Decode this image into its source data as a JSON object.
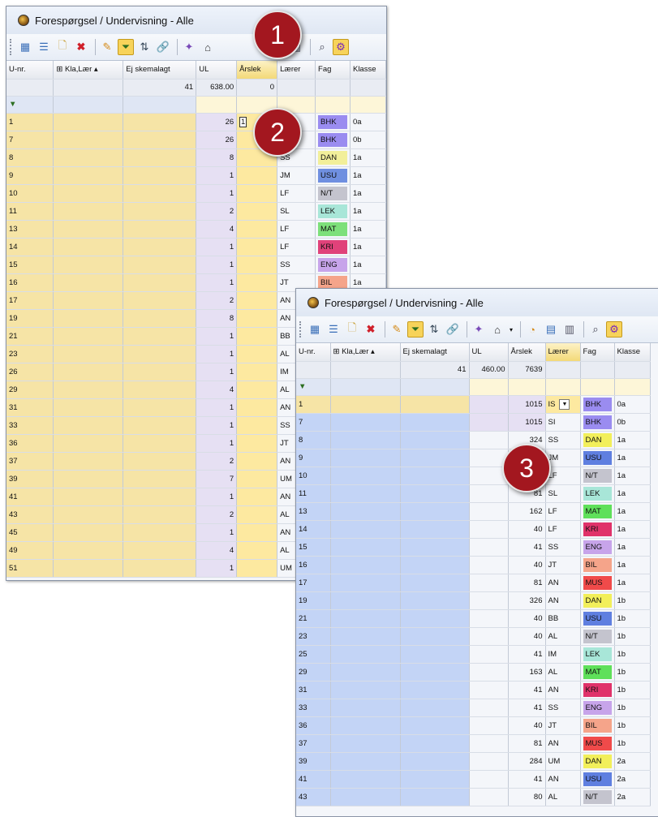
{
  "window1": {
    "title": "Forespørgsel / Undervisning - Alle",
    "columns": [
      "U-nr.",
      "Kla,Lær",
      "Ej skemalagt",
      "UL",
      "Årslek",
      "Lærer",
      "Fag",
      "Klasse"
    ],
    "sum_row": {
      "ej_skemalagt": "41",
      "ul": "638.00",
      "arslek": "0"
    },
    "filter_icon": "funnel-icon",
    "edit_value": "1",
    "rows": [
      {
        "unr": "1",
        "ul": "26",
        "laerer": "",
        "fag": "BHK",
        "fag_color": "#9a8cf0",
        "klasse": "0a"
      },
      {
        "unr": "7",
        "ul": "26",
        "laerer": "",
        "fag": "BHK",
        "fag_color": "#9a8cf0",
        "klasse": "0b"
      },
      {
        "unr": "8",
        "ul": "8",
        "laerer": "SS",
        "fag": "DAN",
        "fag_color": "#f2ef9a",
        "klasse": "1a"
      },
      {
        "unr": "9",
        "ul": "1",
        "laerer": "JM",
        "fag": "USU",
        "fag_color": "#6f8fe0",
        "klasse": "1a"
      },
      {
        "unr": "10",
        "ul": "1",
        "laerer": "LF",
        "fag": "N/T",
        "fag_color": "#c4c4ce",
        "klasse": "1a"
      },
      {
        "unr": "11",
        "ul": "2",
        "laerer": "SL",
        "fag": "LEK",
        "fag_color": "#a8e6d8",
        "klasse": "1a"
      },
      {
        "unr": "13",
        "ul": "4",
        "laerer": "LF",
        "fag": "MAT",
        "fag_color": "#7de07a",
        "klasse": "1a"
      },
      {
        "unr": "14",
        "ul": "1",
        "laerer": "LF",
        "fag": "KRI",
        "fag_color": "#e0427a",
        "klasse": "1a"
      },
      {
        "unr": "15",
        "ul": "1",
        "laerer": "SS",
        "fag": "ENG",
        "fag_color": "#c7a4ea",
        "klasse": "1a"
      },
      {
        "unr": "16",
        "ul": "1",
        "laerer": "JT",
        "fag": "BIL",
        "fag_color": "#f5a48a",
        "klasse": "1a"
      },
      {
        "unr": "17",
        "ul": "2",
        "laerer": "AN",
        "fag": "",
        "fag_color": "",
        "klasse": ""
      },
      {
        "unr": "19",
        "ul": "8",
        "laerer": "AN",
        "fag": "",
        "fag_color": "",
        "klasse": ""
      },
      {
        "unr": "21",
        "ul": "1",
        "laerer": "BB",
        "fag": "",
        "fag_color": "",
        "klasse": ""
      },
      {
        "unr": "23",
        "ul": "1",
        "laerer": "AL",
        "fag": "",
        "fag_color": "",
        "klasse": ""
      },
      {
        "unr": "26",
        "ul": "1",
        "laerer": "IM",
        "fag": "",
        "fag_color": "",
        "klasse": ""
      },
      {
        "unr": "29",
        "ul": "4",
        "laerer": "AL",
        "fag": "",
        "fag_color": "",
        "klasse": ""
      },
      {
        "unr": "31",
        "ul": "1",
        "laerer": "AN",
        "fag": "",
        "fag_color": "",
        "klasse": ""
      },
      {
        "unr": "33",
        "ul": "1",
        "laerer": "SS",
        "fag": "",
        "fag_color": "",
        "klasse": ""
      },
      {
        "unr": "36",
        "ul": "1",
        "laerer": "JT",
        "fag": "",
        "fag_color": "",
        "klasse": ""
      },
      {
        "unr": "37",
        "ul": "2",
        "laerer": "AN",
        "fag": "",
        "fag_color": "",
        "klasse": ""
      },
      {
        "unr": "39",
        "ul": "7",
        "laerer": "UM",
        "fag": "",
        "fag_color": "",
        "klasse": ""
      },
      {
        "unr": "41",
        "ul": "1",
        "laerer": "AN",
        "fag": "",
        "fag_color": "",
        "klasse": ""
      },
      {
        "unr": "43",
        "ul": "2",
        "laerer": "AL",
        "fag": "",
        "fag_color": "",
        "klasse": ""
      },
      {
        "unr": "45",
        "ul": "1",
        "laerer": "AN",
        "fag": "",
        "fag_color": "",
        "klasse": ""
      },
      {
        "unr": "49",
        "ul": "4",
        "laerer": "AL",
        "fag": "",
        "fag_color": "",
        "klasse": ""
      },
      {
        "unr": "51",
        "ul": "1",
        "laerer": "UM",
        "fag": "",
        "fag_color": "",
        "klasse": ""
      }
    ]
  },
  "window2": {
    "title": "Forespørgsel / Undervisning - Alle",
    "columns": [
      "U-nr.",
      "Kla,Lær",
      "Ej skemalagt",
      "UL",
      "Årslek",
      "Lærer",
      "Fag",
      "Klasse"
    ],
    "sum_row": {
      "ej_skemalagt": "41",
      "ul": "460.00",
      "arslek": "7639"
    },
    "filter_icon": "funnel-icon",
    "rows": [
      {
        "unr": "1",
        "arslek": "1015",
        "laerer": "IS",
        "fag": "BHK",
        "fag_color": "#9a8cf0",
        "klasse": "0a"
      },
      {
        "unr": "7",
        "arslek": "1015",
        "laerer": "SI",
        "fag": "BHK",
        "fag_color": "#9a8cf0",
        "klasse": "0b"
      },
      {
        "unr": "8",
        "arslek": "324",
        "laerer": "SS",
        "fag": "DAN",
        "fag_color": "#f2ef5a",
        "klasse": "1a"
      },
      {
        "unr": "9",
        "arslek": "41",
        "laerer": "JM",
        "fag": "USU",
        "fag_color": "#5f7fe0",
        "klasse": "1a"
      },
      {
        "unr": "10",
        "arslek": "41",
        "laerer": "LF",
        "fag": "N/T",
        "fag_color": "#c4c4ce",
        "klasse": "1a"
      },
      {
        "unr": "11",
        "arslek": "81",
        "laerer": "SL",
        "fag": "LEK",
        "fag_color": "#a8e6d8",
        "klasse": "1a"
      },
      {
        "unr": "13",
        "arslek": "162",
        "laerer": "LF",
        "fag": "MAT",
        "fag_color": "#5fe05a",
        "klasse": "1a"
      },
      {
        "unr": "14",
        "arslek": "40",
        "laerer": "LF",
        "fag": "KRI",
        "fag_color": "#e0326a",
        "klasse": "1a"
      },
      {
        "unr": "15",
        "arslek": "41",
        "laerer": "SS",
        "fag": "ENG",
        "fag_color": "#c7a4ea",
        "klasse": "1a"
      },
      {
        "unr": "16",
        "arslek": "40",
        "laerer": "JT",
        "fag": "BIL",
        "fag_color": "#f5a48a",
        "klasse": "1a"
      },
      {
        "unr": "17",
        "arslek": "81",
        "laerer": "AN",
        "fag": "MUS",
        "fag_color": "#f04a4a",
        "klasse": "1a"
      },
      {
        "unr": "19",
        "arslek": "326",
        "laerer": "AN",
        "fag": "DAN",
        "fag_color": "#f2ef5a",
        "klasse": "1b"
      },
      {
        "unr": "21",
        "arslek": "40",
        "laerer": "BB",
        "fag": "USU",
        "fag_color": "#5f7fe0",
        "klasse": "1b"
      },
      {
        "unr": "23",
        "arslek": "40",
        "laerer": "AL",
        "fag": "N/T",
        "fag_color": "#c4c4ce",
        "klasse": "1b"
      },
      {
        "unr": "25",
        "arslek": "41",
        "laerer": "IM",
        "fag": "LEK",
        "fag_color": "#a8e6d8",
        "klasse": "1b"
      },
      {
        "unr": "29",
        "arslek": "163",
        "laerer": "AL",
        "fag": "MAT",
        "fag_color": "#5fe05a",
        "klasse": "1b"
      },
      {
        "unr": "31",
        "arslek": "41",
        "laerer": "AN",
        "fag": "KRI",
        "fag_color": "#e0326a",
        "klasse": "1b"
      },
      {
        "unr": "33",
        "arslek": "41",
        "laerer": "SS",
        "fag": "ENG",
        "fag_color": "#c7a4ea",
        "klasse": "1b"
      },
      {
        "unr": "36",
        "arslek": "40",
        "laerer": "JT",
        "fag": "BIL",
        "fag_color": "#f5a48a",
        "klasse": "1b"
      },
      {
        "unr": "37",
        "arslek": "81",
        "laerer": "AN",
        "fag": "MUS",
        "fag_color": "#f04a4a",
        "klasse": "1b"
      },
      {
        "unr": "39",
        "arslek": "284",
        "laerer": "UM",
        "fag": "DAN",
        "fag_color": "#f2ef5a",
        "klasse": "2a"
      },
      {
        "unr": "41",
        "arslek": "41",
        "laerer": "AN",
        "fag": "USU",
        "fag_color": "#5f7fe0",
        "klasse": "2a"
      },
      {
        "unr": "43",
        "arslek": "80",
        "laerer": "AL",
        "fag": "N/T",
        "fag_color": "#c4c4ce",
        "klasse": "2a"
      }
    ]
  },
  "badges": [
    "1",
    "2",
    "3"
  ]
}
